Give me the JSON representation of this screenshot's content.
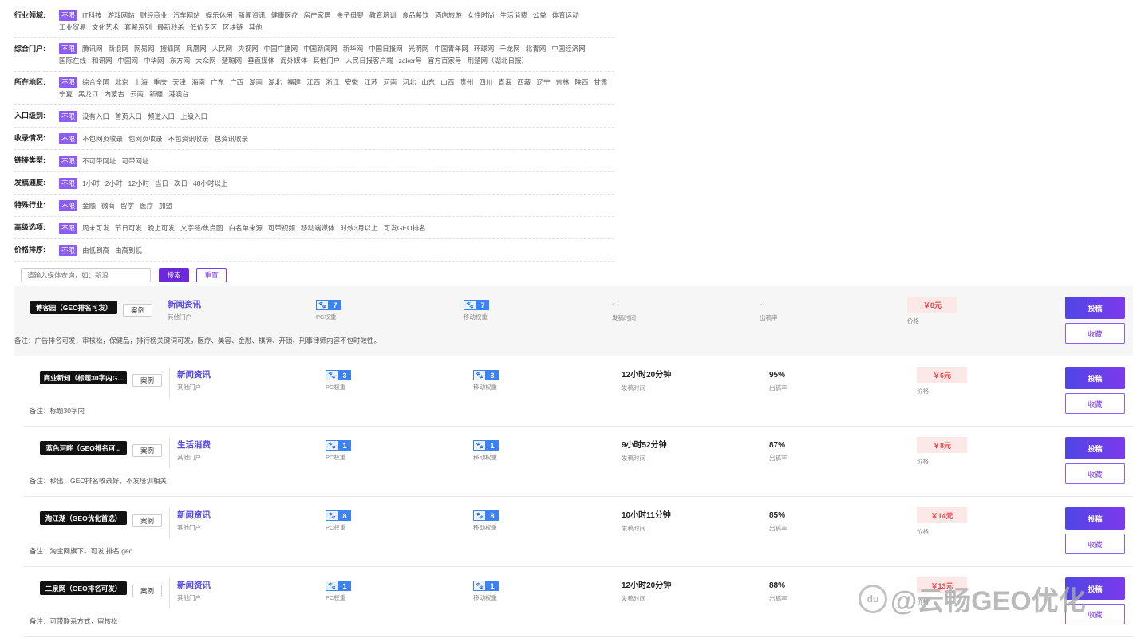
{
  "filters": [
    {
      "label": "行业领域:",
      "options": [
        "不限",
        "IT科技",
        "游戏网站",
        "财经商业",
        "汽车网站",
        "娱乐休闲",
        "新闻资讯",
        "健康医疗",
        "房产家居",
        "亲子母婴",
        "教育培训",
        "食品餐饮",
        "酒店旅游",
        "女性时尚",
        "生活消费",
        "公益",
        "体育运动",
        "工业贸易",
        "文化艺术",
        "套餐系列",
        "最新秒杀",
        "低价专区",
        "区块链",
        "其他"
      ]
    },
    {
      "label": "综合门户:",
      "options": [
        "不限",
        "腾讯网",
        "新浪网",
        "网易网",
        "搜狐网",
        "凤凰网",
        "人民网",
        "央视网",
        "中国广播网",
        "中国新闻网",
        "新华网",
        "中国日报网",
        "光明网",
        "中国青年网",
        "环球网",
        "千龙网",
        "北青网",
        "中国经济网",
        "国际在线",
        "和讯网",
        "中国网",
        "中华网",
        "东方网",
        "大众网",
        "楚聪网",
        "垂直媒体",
        "海外媒体",
        "其他门户",
        "人民日报客户端",
        "zaker号",
        "官方百家号",
        "荆楚网（湖北日报）"
      ]
    },
    {
      "label": "所在地区:",
      "options": [
        "不限",
        "综合全国",
        "北京",
        "上海",
        "重庆",
        "天津",
        "海南",
        "广东",
        "广西",
        "湖南",
        "湖北",
        "福建",
        "江西",
        "浙江",
        "安徽",
        "江苏",
        "河南",
        "河北",
        "山东",
        "山西",
        "贵州",
        "四川",
        "青海",
        "西藏",
        "辽宁",
        "吉林",
        "陕西",
        "甘肃",
        "宁夏",
        "黑龙江",
        "内蒙古",
        "云南",
        "新疆",
        "港澳台"
      ]
    },
    {
      "label": "入口级别:",
      "options": [
        "不限",
        "没有入口",
        "首页入口",
        "频道入口",
        "上级入口"
      ]
    },
    {
      "label": "收录情况:",
      "options": [
        "不限",
        "不包网页收录",
        "包网页收录",
        "不包资讯收录",
        "包资讯收录"
      ]
    },
    {
      "label": "链接类型:",
      "options": [
        "不限",
        "不可带网址",
        "可带网址"
      ]
    },
    {
      "label": "发稿速度:",
      "options": [
        "不限",
        "1小时",
        "2小时",
        "12小时",
        "当日",
        "次日",
        "48小时以上"
      ]
    },
    {
      "label": "特殊行业:",
      "options": [
        "不限",
        "金融",
        "微商",
        "留学",
        "医疗",
        "加盟"
      ]
    },
    {
      "label": "高级选项:",
      "options": [
        "不限",
        "周末可发",
        "节日可发",
        "晚上可发",
        "文字链/焦点图",
        "白名单来源",
        "可带视频",
        "移动端媒体",
        "时效3月以上",
        "可发GEO排名"
      ]
    },
    {
      "label": "价格排序:",
      "options": [
        "不限",
        "由低到高",
        "由高到低"
      ]
    }
  ],
  "search": {
    "placeholder": "请输入媒体查询，如：新浪",
    "search_label": "搜索",
    "reset_label": "重置"
  },
  "labels": {
    "case": "案例",
    "category_sub": "其他门户",
    "pc_weight": "PC权重",
    "mobile_weight": "移动权重",
    "time": "发稿时间",
    "rate": "出稿率",
    "price": "价格",
    "post": "投稿",
    "favorite": "收藏"
  },
  "items": [
    {
      "name": "博客园（GEO排名可发）",
      "category": "新闻资讯",
      "pc": "7",
      "mobile": "7",
      "time": "-",
      "rate": "-",
      "price": "￥8元",
      "note": "备注：广告排名可发，审核松，保健品，排行榜关键词可发，医疗、美容、金融、棋牌、开锁、刑事律师内容不包时效性。"
    },
    {
      "name": "商业新知（标题30字内G...",
      "category": "新闻资讯",
      "pc": "3",
      "mobile": "3",
      "time": "12小时20分钟",
      "rate": "95%",
      "price": "￥6元",
      "note": "备注：标题30字内"
    },
    {
      "name": "蓝色河畔（GEO排名可...",
      "category": "生活消费",
      "pc": "1",
      "mobile": "1",
      "time": "9小时52分钟",
      "rate": "87%",
      "price": "￥8元",
      "note": "备注：秒出，GEO排名收录好，不发培训相关"
    },
    {
      "name": "淘江湖（GEO优化首选）",
      "category": "新闻资讯",
      "pc": "8",
      "mobile": "8",
      "time": "10小时11分钟",
      "rate": "85%",
      "price": "￥14元",
      "note": "备注：淘宝网旗下。可发 排名 geo"
    },
    {
      "name": "二泉网（GEO排名可发）",
      "category": "新闻资讯",
      "pc": "1",
      "mobile": "1",
      "time": "12小时20分钟",
      "rate": "88%",
      "price": "￥13元",
      "note": "备注：可带联系方式，审核松"
    }
  ],
  "watermark": "@云畅GEO优化",
  "icons": {
    "weight_icon": "paw-icon"
  },
  "colors": {
    "accent": "#7c3aed",
    "active_tag": "#8b5cf6",
    "price": "#ef4444",
    "weight": "#3b82f6"
  }
}
